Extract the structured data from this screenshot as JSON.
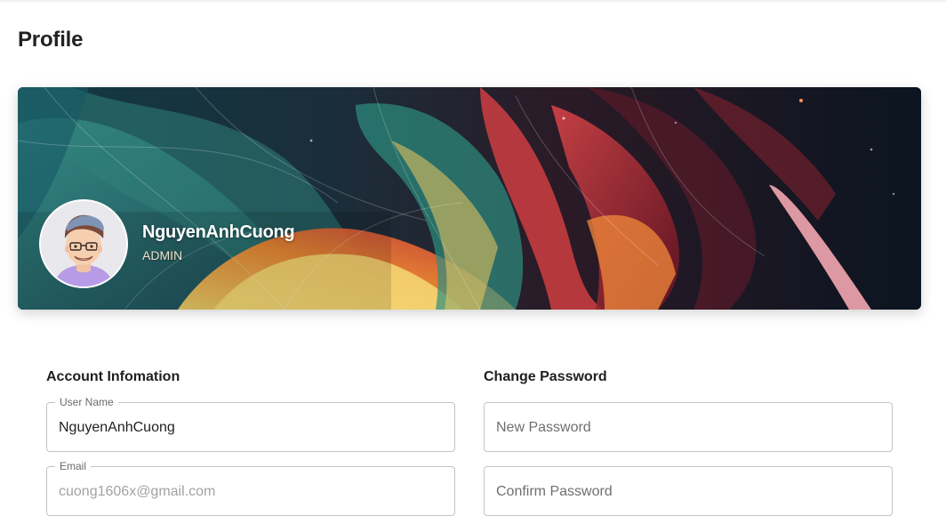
{
  "page": {
    "title": "Profile"
  },
  "profile": {
    "name": "NguyenAnhCuong",
    "role": "ADMIN"
  },
  "account": {
    "section_title": "Account Infomation",
    "username": {
      "label": "User Name",
      "value": "NguyenAnhCuong"
    },
    "email": {
      "label": "Email",
      "value": "cuong1606x@gmail.com"
    }
  },
  "password": {
    "section_title": "Change Password",
    "new_password": {
      "placeholder": "New Password"
    },
    "confirm_password": {
      "placeholder": "Confirm Password"
    }
  },
  "colors": {
    "banner_dark": "#0d1a26",
    "banner_teal": "#2f7f7a",
    "banner_red": "#c8343a",
    "banner_orange": "#e8902f",
    "banner_yellow": "#f2cf5b",
    "field_border": "#c4c4c4"
  },
  "icons": {
    "avatar": "cartoon-user-avatar"
  }
}
